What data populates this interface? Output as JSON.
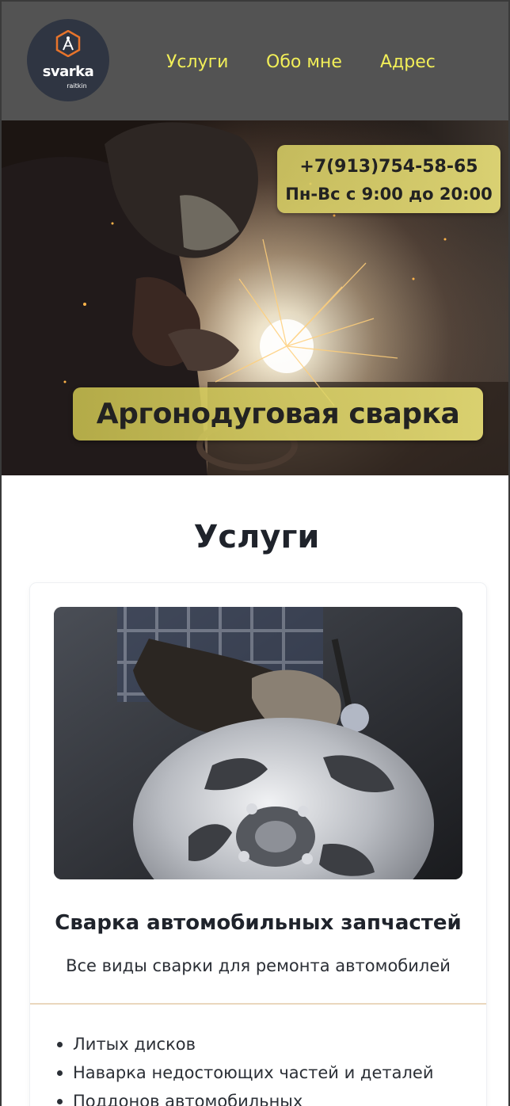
{
  "brand": {
    "logo_text": "svarka",
    "logo_sub": "raitkin",
    "accent_color": "#e8742b"
  },
  "nav": {
    "items": [
      {
        "label": "Услуги"
      },
      {
        "label": "Обо мне"
      },
      {
        "label": "Адрес"
      }
    ],
    "link_color": "#f2ef58"
  },
  "hero": {
    "phone": "+7(913)754-58-65",
    "hours": "Пн-Вс с 9:00 до 20:00",
    "title": "Аргонодуговая сварка",
    "image_desc": "welder-with-sparks-photo"
  },
  "services": {
    "section_title": "Услуги",
    "cards": [
      {
        "image_desc": "wheel-welding-photo",
        "title": "Сварка автомобильных запчастей",
        "description": "Все виды сварки для ремонта автомобилей",
        "items": [
          "Литых дисков",
          "Наварка недостоющих частей и деталей",
          "Поддонов автомобильных"
        ]
      }
    ]
  }
}
